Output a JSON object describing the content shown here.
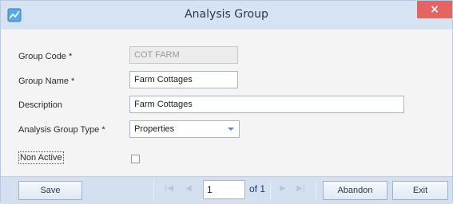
{
  "window": {
    "title": "Analysis Group",
    "close_label": "×"
  },
  "form": {
    "group_code": {
      "label": "Group Code *",
      "value": "COT FARM"
    },
    "group_name": {
      "label": "Group Name *",
      "value": "Farm Cottages"
    },
    "description": {
      "label": "Description",
      "value": "Farm Cottages"
    },
    "analysis_group_type": {
      "label": "Analysis Group Type *",
      "value": "Properties"
    },
    "non_active": {
      "label": "Non Active",
      "checked": false
    }
  },
  "footer": {
    "save_label": "Save",
    "nav_first": "|◀",
    "nav_prev": "◀",
    "page_value": "1",
    "page_total_label": "of 1",
    "nav_next": "▶",
    "nav_last": "▶|",
    "abandon_label": "Abandon",
    "exit_label": "Exit"
  },
  "colors": {
    "titlebar": "#d6e3f3",
    "close": "#e46464",
    "footer": "#d4e0f0"
  }
}
